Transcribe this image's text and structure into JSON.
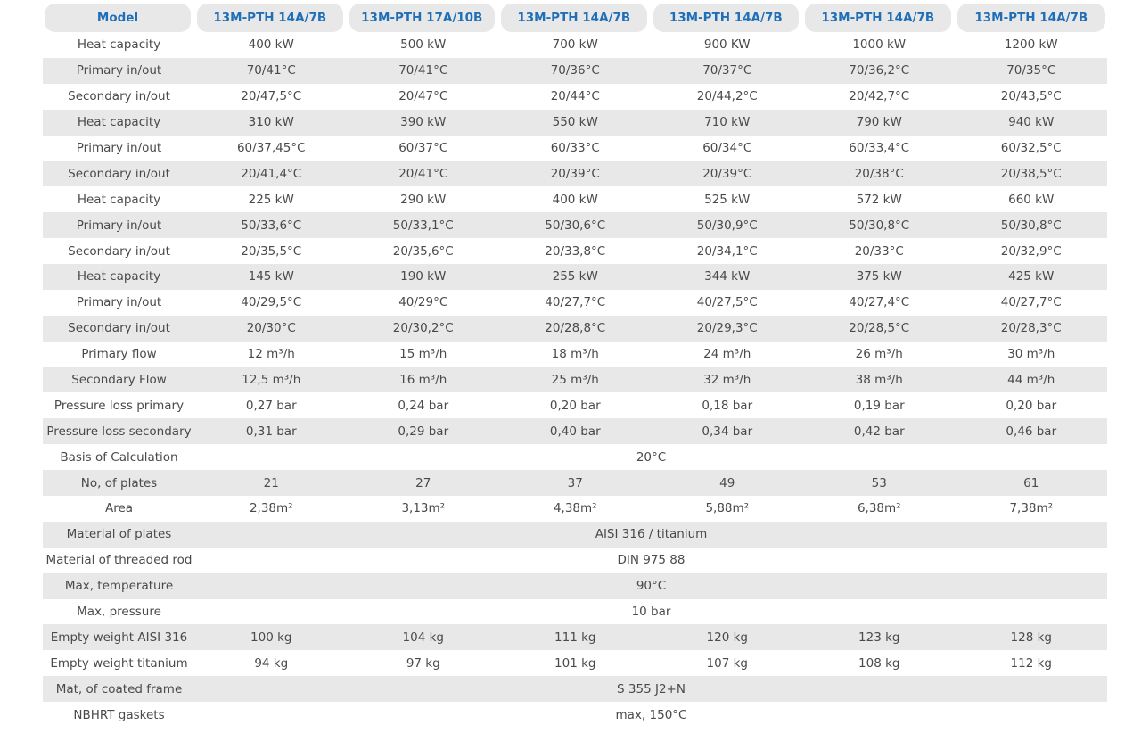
{
  "table": {
    "header_label": "Model",
    "models": [
      "13M-PTH 14A/7B",
      "13M-PTH 17A/10B",
      "13M-PTH 14A/7B",
      "13M-PTH 14A/7B",
      "13M-PTH 14A/7B",
      "13M-PTH 14A/7B"
    ],
    "rows": [
      {
        "label": "Heat capacity",
        "values": [
          "400 kW",
          "500 kW",
          "700 kW",
          "900 KW",
          "1000 kW",
          "1200 kW"
        ]
      },
      {
        "label": "Primary in/out",
        "values": [
          "70/41°C",
          "70/41°C",
          "70/36°C",
          "70/37°C",
          "70/36,2°C",
          "70/35°C"
        ]
      },
      {
        "label": "Secondary in/out",
        "values": [
          "20/47,5°C",
          "20/47°C",
          "20/44°C",
          "20/44,2°C",
          "20/42,7°C",
          "20/43,5°C"
        ]
      },
      {
        "label": "Heat capacity",
        "values": [
          "310 kW",
          "390 kW",
          "550 kW",
          "710 kW",
          "790 kW",
          "940 kW"
        ]
      },
      {
        "label": "Primary in/out",
        "values": [
          "60/37,45°C",
          "60/37°C",
          "60/33°C",
          "60/34°C",
          "60/33,4°C",
          "60/32,5°C"
        ]
      },
      {
        "label": "Secondary in/out",
        "values": [
          "20/41,4°C",
          "20/41°C",
          "20/39°C",
          "20/39°C",
          "20/38°C",
          "20/38,5°C"
        ]
      },
      {
        "label": "Heat capacity",
        "values": [
          "225 kW",
          "290 kW",
          "400 kW",
          "525 kW",
          "572 kW",
          "660 kW"
        ]
      },
      {
        "label": "Primary in/out",
        "values": [
          "50/33,6°C",
          "50/33,1°C",
          "50/30,6°C",
          "50/30,9°C",
          "50/30,8°C",
          "50/30,8°C"
        ]
      },
      {
        "label": "Secondary in/out",
        "values": [
          "20/35,5°C",
          "20/35,6°C",
          "20/33,8°C",
          "20/34,1°C",
          "20/33°C",
          "20/32,9°C"
        ]
      },
      {
        "label": "Heat capacity",
        "values": [
          "145 kW",
          "190 kW",
          "255 kW",
          "344 kW",
          "375 kW",
          "425 kW"
        ]
      },
      {
        "label": "Primary in/out",
        "values": [
          "40/29,5°C",
          "40/29°C",
          "40/27,7°C",
          "40/27,5°C",
          "40/27,4°C",
          "40/27,7°C"
        ]
      },
      {
        "label": "Secondary in/out",
        "values": [
          "20/30°C",
          "20/30,2°C",
          "20/28,8°C",
          "20/29,3°C",
          "20/28,5°C",
          "20/28,3°C"
        ]
      },
      {
        "label": "Primary flow",
        "values": [
          "12 m³/h",
          "15 m³/h",
          "18 m³/h",
          "24 m³/h",
          "26 m³/h",
          "30 m³/h"
        ]
      },
      {
        "label": "Secondary Flow",
        "values": [
          "12,5 m³/h",
          "16 m³/h",
          "25 m³/h",
          "32 m³/h",
          "38 m³/h",
          "44 m³/h"
        ]
      },
      {
        "label": "Pressure loss primary",
        "values": [
          "0,27 bar",
          "0,24 bar",
          "0,20 bar",
          "0,18 bar",
          "0,19 bar",
          "0,20 bar"
        ]
      },
      {
        "label": "Pressure loss secondary",
        "values": [
          "0,31 bar",
          "0,29 bar",
          "0,40 bar",
          "0,34 bar",
          "0,42 bar",
          "0,46 bar"
        ]
      },
      {
        "label": "Basis of Calculation",
        "span": "20°C"
      },
      {
        "label": "No, of plates",
        "values": [
          "21",
          "27",
          "37",
          "49",
          "53",
          "61"
        ]
      },
      {
        "label": "Area",
        "values": [
          "2,38m²",
          "3,13m²",
          "4,38m²",
          "5,88m²",
          "6,38m²",
          "7,38m²"
        ]
      },
      {
        "label": "Material of plates",
        "span": "AISI 316 / titanium"
      },
      {
        "label": "Material of threaded rod",
        "span": "DIN 975 88"
      },
      {
        "label": "Max, temperature",
        "span": "90°C"
      },
      {
        "label": "Max, pressure",
        "span": "10 bar"
      },
      {
        "label": "Empty weight AISI 316",
        "values": [
          "100 kg",
          "104 kg",
          "111 kg",
          "120 kg",
          "123 kg",
          "128 kg"
        ]
      },
      {
        "label": "Empty weight titanium",
        "values": [
          "94 kg",
          "97 kg",
          "101 kg",
          "107 kg",
          "108 kg",
          "112 kg"
        ]
      },
      {
        "label": "Mat, of coated frame",
        "span": "S 355 J2+N"
      },
      {
        "label": "NBHRT gaskets",
        "span": "max, 150°C"
      }
    ]
  }
}
